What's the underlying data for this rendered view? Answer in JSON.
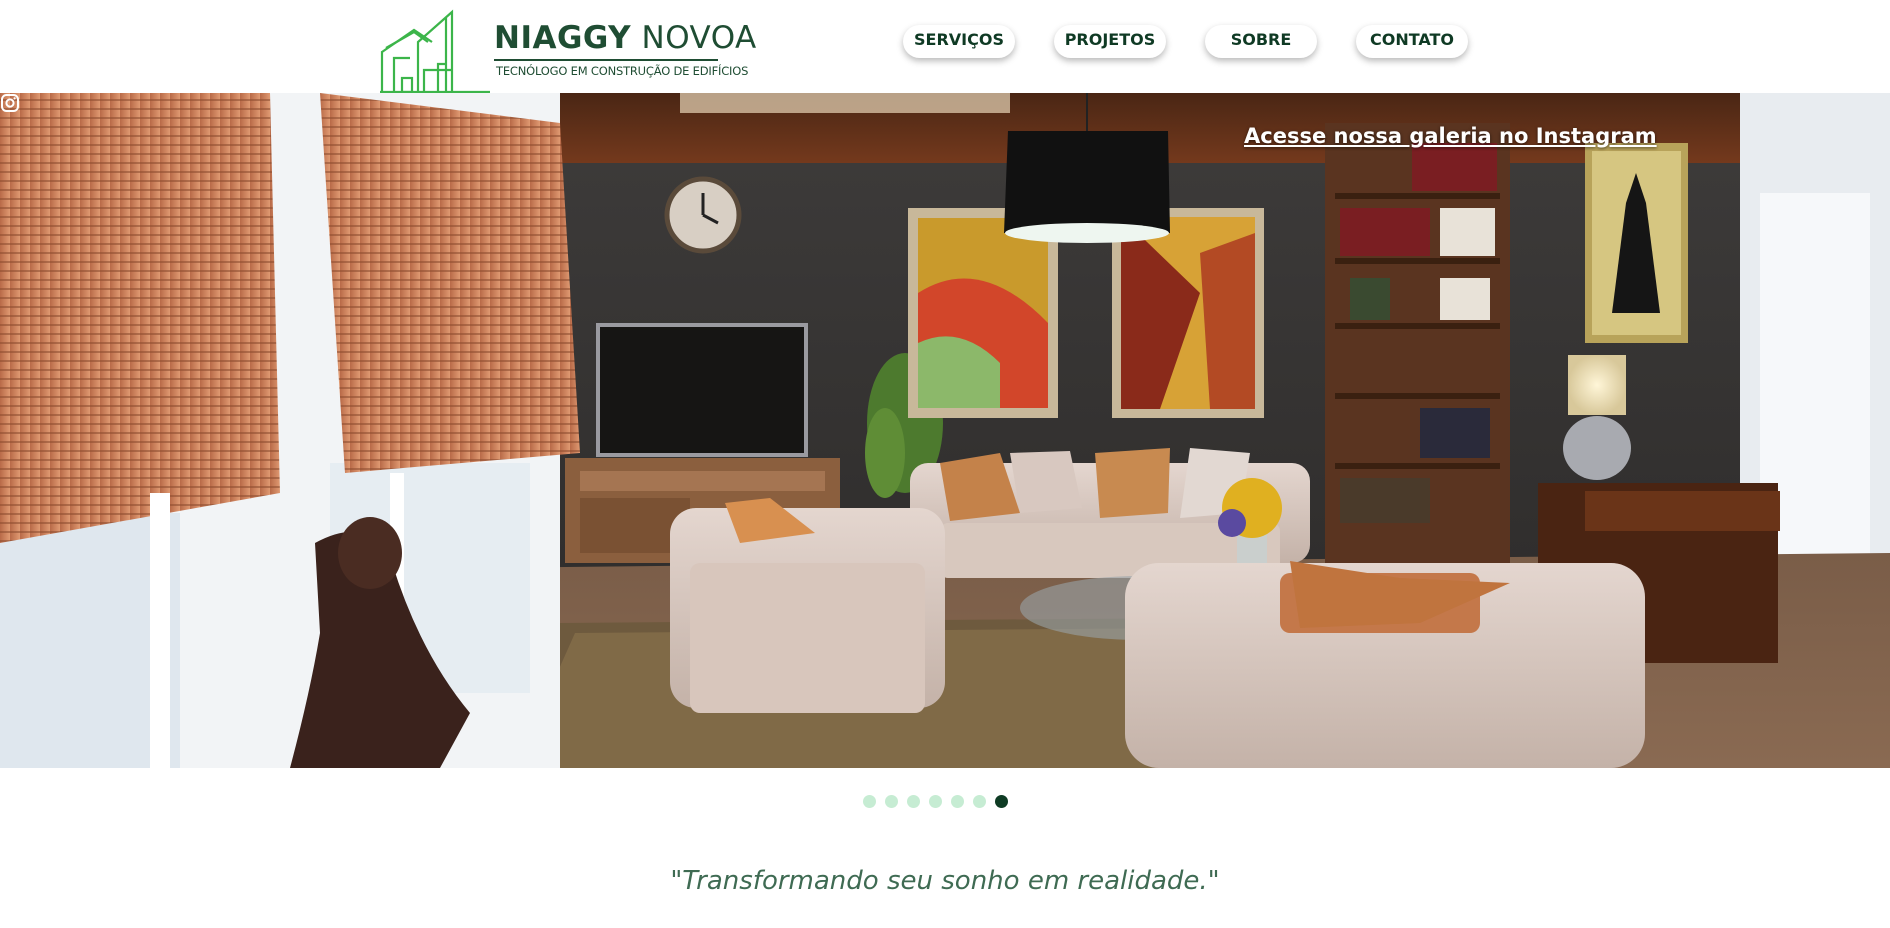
{
  "brand": {
    "name_bold": "NIAGGY",
    "name_light": "NOVOA",
    "tagline": "TECNÓLOGO EM CONSTRUÇÃO DE EDIFÍCIOS",
    "logo_icon": "buildings-outline-icon",
    "primary_color": "#1f4d33",
    "logo_green": "#3cb54a"
  },
  "nav": {
    "items": [
      {
        "label": "SERVIÇOS"
      },
      {
        "label": "PROJETOS"
      },
      {
        "label": "SOBRE"
      },
      {
        "label": "CONTATO"
      }
    ]
  },
  "hero": {
    "instagram_link": "Acesse nossa galeria no Instagram",
    "instagram_icon": "instagram-icon",
    "image_subject": "living room interior"
  },
  "slider": {
    "total_slides": 7,
    "active_index": 6,
    "active_color": "#0e3b24",
    "inactive_color": "#c6ecd3"
  },
  "tagline": "\"Transformando seu sonho em realidade.\""
}
